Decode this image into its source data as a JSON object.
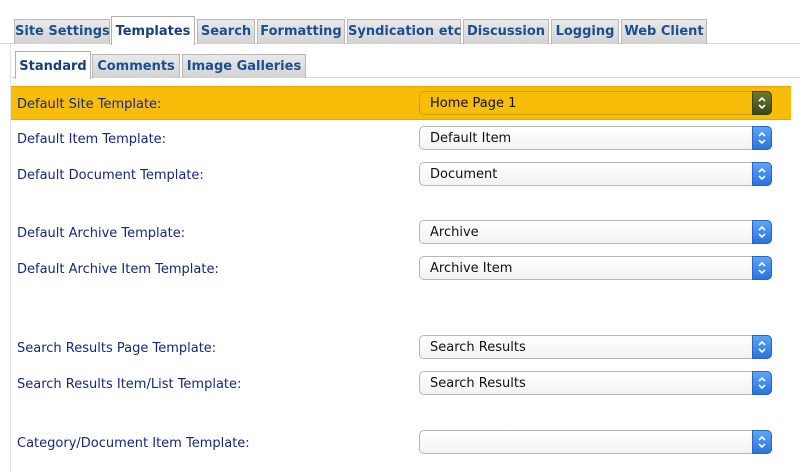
{
  "tabs": [
    {
      "label": "Site Settings"
    },
    {
      "label": "Templates"
    },
    {
      "label": "Search"
    },
    {
      "label": "Formatting"
    },
    {
      "label": "Syndication etc"
    },
    {
      "label": "Discussion"
    },
    {
      "label": "Logging"
    },
    {
      "label": "Web Client"
    }
  ],
  "active_tab": "Templates",
  "subtabs": [
    {
      "label": "Standard"
    },
    {
      "label": "Comments"
    },
    {
      "label": "Image Galleries"
    }
  ],
  "active_subtab": "Standard",
  "fields": [
    {
      "label": "Default Site Template:",
      "value": "Home Page 1",
      "highlighted": true
    },
    {
      "label": "Default Item Template:",
      "value": "Default Item"
    },
    {
      "label": "Default Document Template:",
      "value": "Document"
    },
    {
      "label": "Default Archive Template:",
      "value": "Archive"
    },
    {
      "label": "Default Archive Item Template:",
      "value": "Archive Item"
    },
    {
      "label": "Search Results Page Template:",
      "value": "Search Results"
    },
    {
      "label": "Search Results Item/List Template:",
      "value": "Search Results"
    },
    {
      "label": "Category/Document Item Template:",
      "value": ""
    }
  ],
  "colors": {
    "highlight": "#f8bd08",
    "tab_text": "#1a4f91",
    "label_text": "#17277a",
    "select_button": "#2a72e0"
  },
  "icons": {
    "select_arrows": "up-down-chevron-icon"
  }
}
